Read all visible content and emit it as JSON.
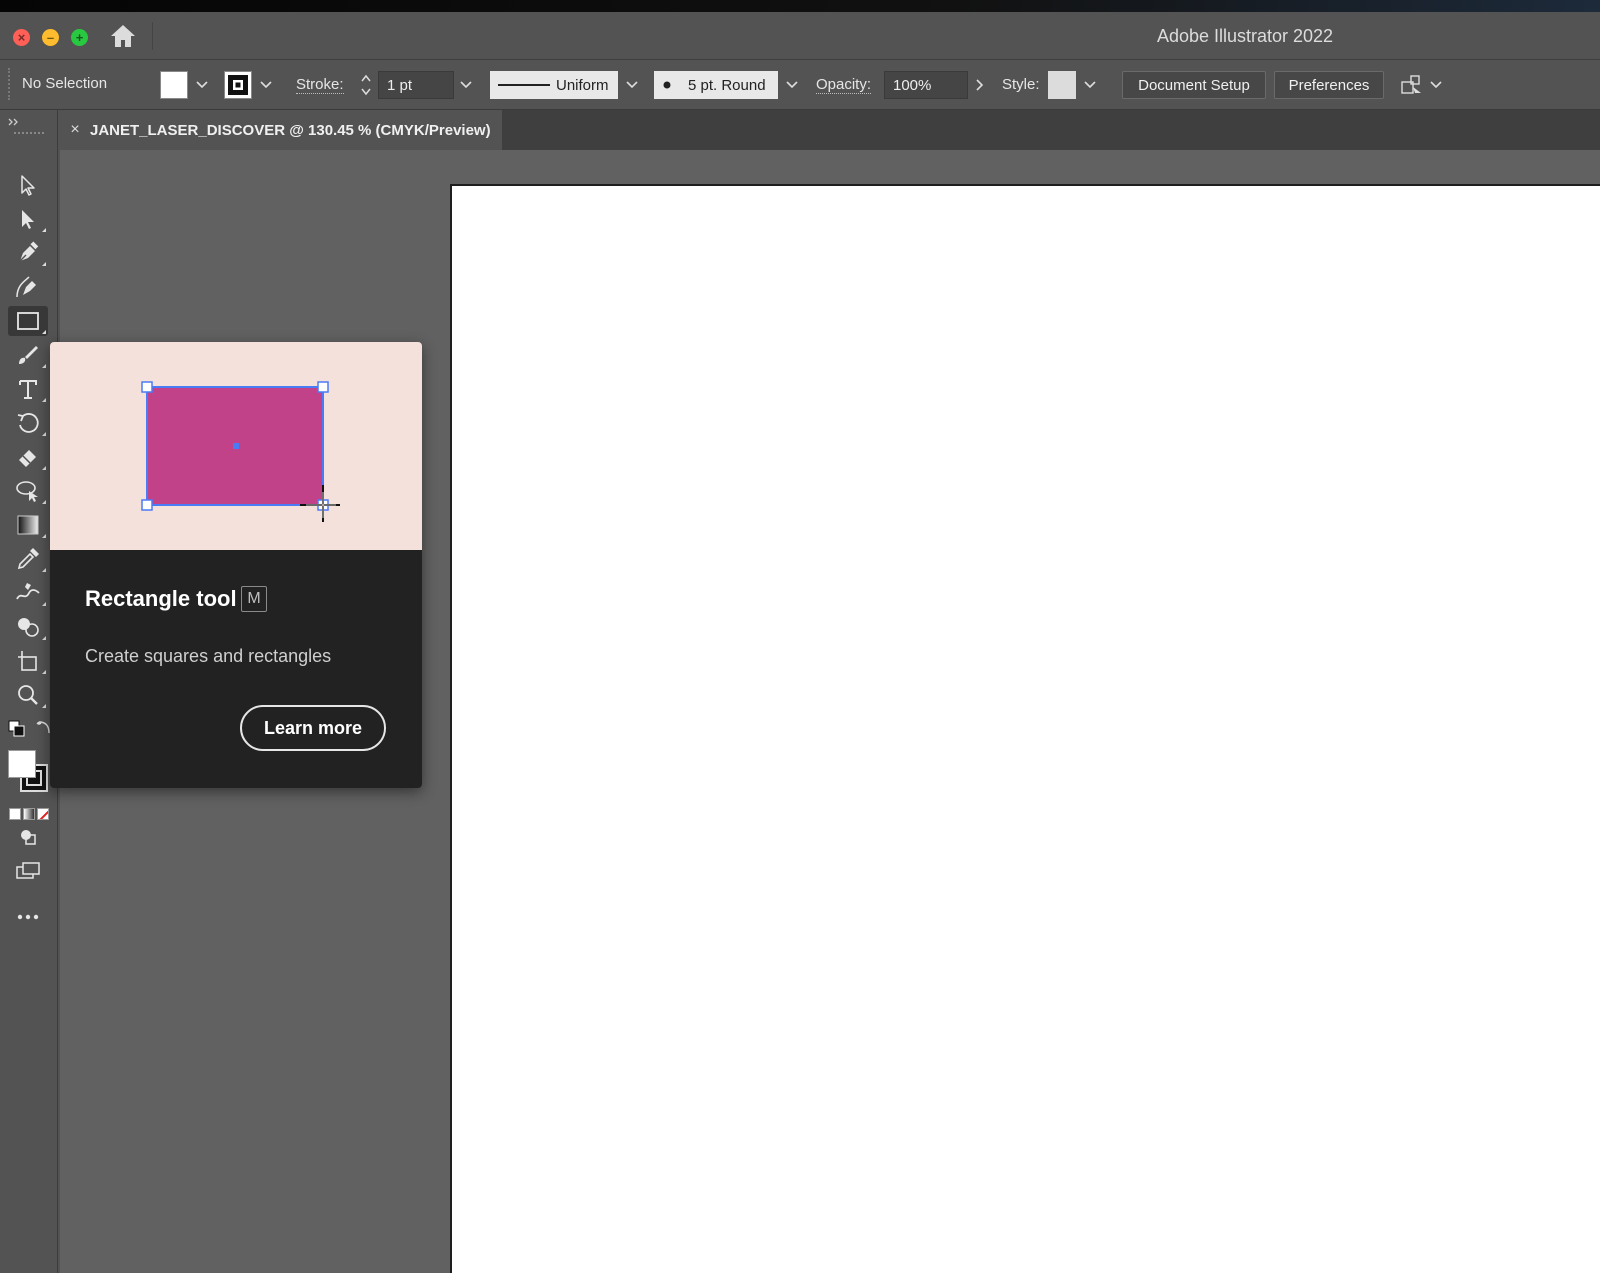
{
  "window": {
    "app_title": "Adobe Illustrator 2022"
  },
  "control_bar": {
    "selection_label": "No Selection",
    "stroke_label": "Stroke:",
    "stroke_weight": "1 pt",
    "stroke_profile": "Uniform",
    "brush_label": "5 pt. Round",
    "opacity_label": "Opacity:",
    "opacity_value": "100%",
    "style_label": "Style:",
    "document_setup_label": "Document Setup",
    "preferences_label": "Preferences"
  },
  "document": {
    "tab_close": "×",
    "tab_title": "JANET_LASER_DISCOVER @ 130.45 % (CMYK/Preview)"
  },
  "tooltip": {
    "title": "Rectangle tool",
    "shortcut": "M",
    "description": "Create squares and rectangles",
    "learn_more_label": "Learn more"
  },
  "tools": [
    {
      "name": "selection-tool",
      "icon": "arrow-outline-icon"
    },
    {
      "name": "direct-selection-tool",
      "icon": "arrow-filled-icon"
    },
    {
      "name": "pen-tool",
      "icon": "pen-icon"
    },
    {
      "name": "curvature-tool",
      "icon": "curvature-pen-icon"
    },
    {
      "name": "rectangle-tool",
      "icon": "rectangle-icon",
      "active": true
    },
    {
      "name": "paintbrush-tool",
      "icon": "brush-icon"
    },
    {
      "name": "type-tool",
      "icon": "type-icon"
    },
    {
      "name": "rotate-tool",
      "icon": "rotate-icon"
    },
    {
      "name": "eraser-tool",
      "icon": "eraser-icon"
    },
    {
      "name": "lasso-tool",
      "icon": "lasso-icon"
    },
    {
      "name": "gradient-tool",
      "icon": "gradient-icon"
    },
    {
      "name": "eyedropper-tool",
      "icon": "eyedropper-icon"
    },
    {
      "name": "puppet-warp-tool",
      "icon": "puppet-icon"
    },
    {
      "name": "shape-builder-tool",
      "icon": "shape-builder-icon"
    },
    {
      "name": "artboard-tool",
      "icon": "artboard-icon"
    },
    {
      "name": "zoom-tool",
      "icon": "magnifier-icon"
    }
  ],
  "colors": {
    "chrome": "#535353",
    "canvas": "#616161",
    "tooltip_preview_bg": "#f5e1dc",
    "tooltip_body_bg": "#222222",
    "rectangle_fill": "#c2428a",
    "selection_blue": "#4a7bf7"
  }
}
